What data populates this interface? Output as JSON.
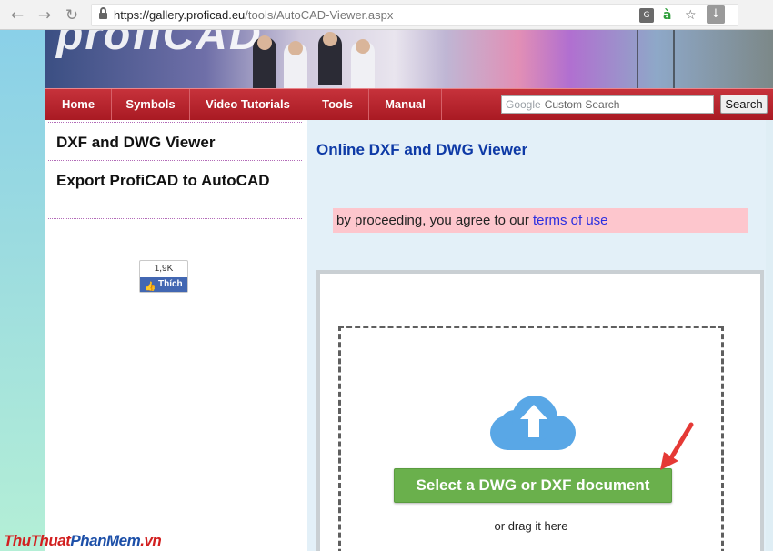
{
  "browser": {
    "url_host": "https://gallery.proficad.eu",
    "url_path": "/tools/AutoCAD-Viewer.aspx",
    "icons": {
      "back": "←",
      "forward": "→",
      "reload": "↻",
      "translate": "G",
      "extension": "à",
      "star": "☆",
      "download": "↓"
    }
  },
  "banner": {
    "logo_text": "profiCAD"
  },
  "nav": {
    "items": [
      "Home",
      "Symbols",
      "Video Tutorials",
      "Tools",
      "Manual"
    ],
    "search_brand": "Google",
    "search_placeholder": "Custom Search",
    "search_button": "Search"
  },
  "sidebar": {
    "links": [
      "DXF and DWG Viewer",
      "Export ProfiCAD to AutoCAD"
    ],
    "fb": {
      "count": "1,9K",
      "label": "Thích",
      "thumb": "👍"
    }
  },
  "main": {
    "title": "Online DXF and DWG Viewer",
    "terms_prefix": "by proceeding, you agree to our ",
    "terms_link": "terms of use",
    "upload_button": "Select a DWG or DXF document",
    "drag_text": "or drag it here"
  },
  "watermark": {
    "part1": "ThuThuat",
    "part2": "PhanMem",
    "part3": ".vn"
  },
  "colors": {
    "nav_red": "#b3222b",
    "title_blue": "#0e3aa6",
    "button_green": "#6ab04c",
    "cloud_blue": "#59a7e6",
    "arrow_red": "#e53935"
  }
}
